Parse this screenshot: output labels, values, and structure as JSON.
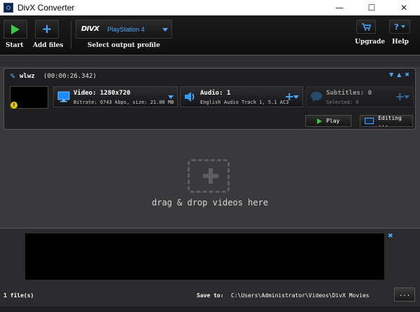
{
  "window": {
    "title": "DivX Converter"
  },
  "toolbar": {
    "start_label": "Start",
    "add_files_label": "Add files",
    "profile_brand": "DIVX",
    "profile_value": "PlayStation 4",
    "profile_caption": "Select output profile",
    "upgrade_label": "Upgrade",
    "help_label": "Help",
    "help_glyph": "?"
  },
  "item": {
    "name": "wlwz",
    "duration": "(00:00:26.342)",
    "video": {
      "title": "Video: 1280x720",
      "detail": "Bitrate: 6743 kbps, size: 21.00 MB"
    },
    "audio": {
      "title": "Audio: 1",
      "detail": "English Audio Track 1, 5.1 AC3"
    },
    "subtitles": {
      "title": "Subtitles: 0",
      "detail": "Selected: 0"
    },
    "play_label": "Play",
    "editing_label": "Editing ..."
  },
  "dropzone": {
    "text": "drag & drop videos here"
  },
  "footer": {
    "file_count": "1 file(s)",
    "save_to_label": "Save to:",
    "save_to_path": "C:\\Users\\Administrator\\Videos\\DivX Movies",
    "browse_label": "..."
  },
  "colors": {
    "accent": "#4aa8ff",
    "play_green": "#3cc84a",
    "warning": "#e6c800"
  }
}
